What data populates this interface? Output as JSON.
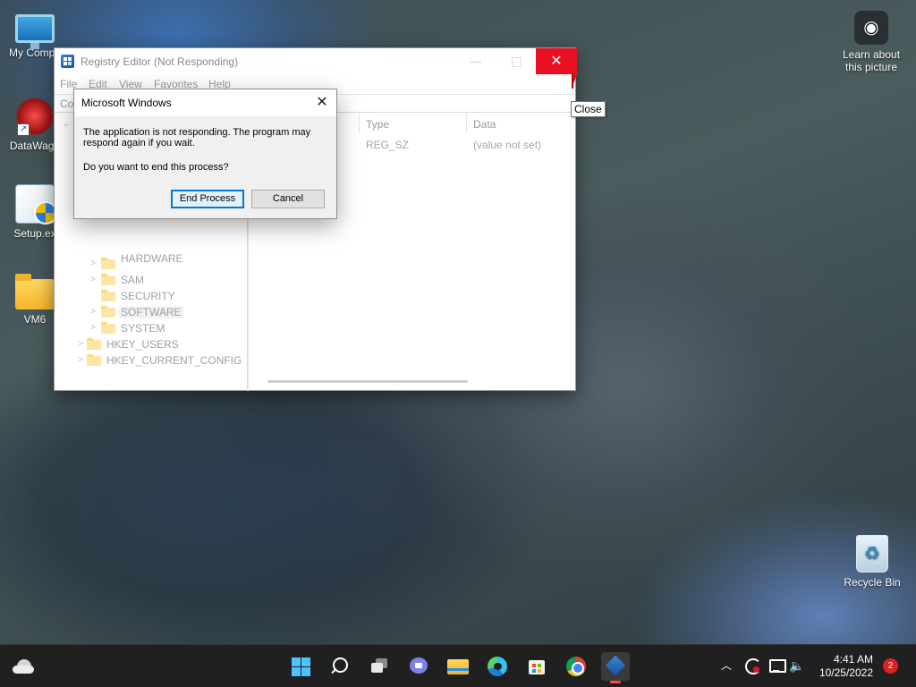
{
  "desktop": {
    "icons": [
      {
        "label": "My Compu"
      },
      {
        "label": "DataWago"
      },
      {
        "label": "Setup.ex"
      },
      {
        "label": "VM6"
      },
      {
        "label": "Recycle Bin"
      }
    ],
    "spotlight": {
      "label_line1": "Learn about",
      "label_line2": "this picture"
    }
  },
  "registry_window": {
    "title": "Registry Editor (Not Responding)",
    "menu": [
      "File",
      "Edit",
      "View",
      "Favorites",
      "Help"
    ],
    "address_text": "Co",
    "tree": [
      {
        "label": "HARDWARE",
        "expander": ">"
      },
      {
        "label": "SAM",
        "expander": ">"
      },
      {
        "label": "SECURITY",
        "expander": ""
      },
      {
        "label": "SOFTWARE",
        "expander": ">"
      },
      {
        "label": "SYSTEM",
        "expander": ">"
      },
      {
        "label": "HKEY_USERS",
        "expander": ">"
      },
      {
        "label": "HKEY_CURRENT_CONFIG",
        "expander": ">"
      }
    ],
    "columns": {
      "type": "Type",
      "data": "Data"
    },
    "row": {
      "type": "REG_SZ",
      "data": "(value not set)"
    }
  },
  "dialog": {
    "title": "Microsoft Windows",
    "message_line1": "The application is not responding. The program may",
    "message_line2": "respond again if you wait.",
    "question": "Do you want to end this process?",
    "primary_button": "End Process",
    "cancel_button": "Cancel"
  },
  "tooltip": {
    "text": "Close"
  },
  "taskbar": {
    "clock_time": "4:41 AM",
    "clock_date": "10/25/2022",
    "notification_count": "2"
  },
  "colors": {
    "close_red": "#e81123",
    "taskbar": "#202020",
    "accent": "#0078d7"
  }
}
